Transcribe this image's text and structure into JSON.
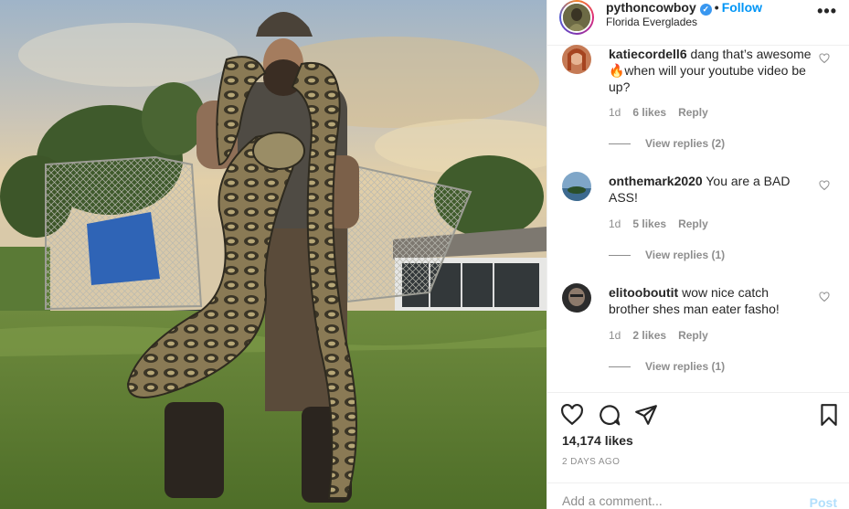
{
  "post": {
    "username": "pythoncowboy",
    "follow_label": "Follow",
    "separator": "•",
    "location": "Florida Everglades",
    "more_label": "•••"
  },
  "comments": [
    {
      "username": "katiecordell6",
      "text": "dang that’s awesome🔥when will your youtube video be up?",
      "age": "1d",
      "likes": "6 likes",
      "reply_label": "Reply",
      "view_replies": "View replies (2)"
    },
    {
      "username": "onthemark2020",
      "text": "You are a BAD ASS!",
      "age": "1d",
      "likes": "5 likes",
      "reply_label": "Reply",
      "view_replies": "View replies (1)"
    },
    {
      "username": "elitooboutit",
      "text": "wow nice catch brother shes man eater fasho!",
      "age": "1d",
      "likes": "2 likes",
      "reply_label": "Reply",
      "view_replies": "View replies (1)"
    }
  ],
  "engagement": {
    "likes_count": "14,174 likes",
    "posted_ago": "2 DAYS AGO"
  },
  "composer": {
    "placeholder": "Add a comment...",
    "post_label": "Post"
  },
  "icons": {
    "like": "heart-icon",
    "comment": "comment-bubble-icon",
    "share": "paper-plane-icon",
    "save": "bookmark-icon",
    "verified": "verified-badge-icon",
    "more": "more-options-icon"
  },
  "colors": {
    "accent": "#0095f6",
    "verified": "#3897f0",
    "muted": "#8e8e8e",
    "post_disabled": "#b2dffc"
  }
}
